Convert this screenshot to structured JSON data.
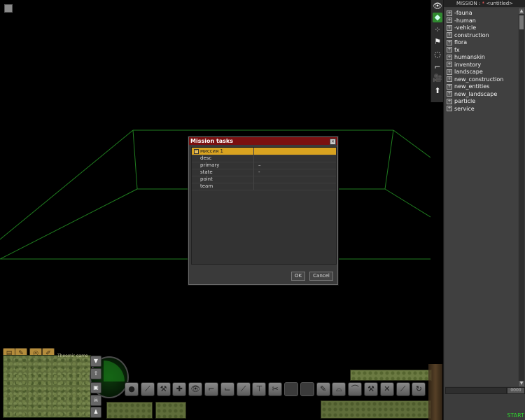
{
  "mission_header": {
    "label": "MISSION :",
    "modified_mark": "*",
    "name": "<untitled>"
  },
  "tool_strip": [
    {
      "name": "eye-icon",
      "glyph": "👁"
    },
    {
      "name": "entity-tool-icon",
      "glyph": "◆"
    },
    {
      "name": "grid-select-icon",
      "glyph": "⁘"
    },
    {
      "name": "flag-icon",
      "glyph": "⚑"
    },
    {
      "name": "circle-select-icon",
      "glyph": "◌"
    },
    {
      "name": "path-icon",
      "glyph": "⌐"
    },
    {
      "name": "camera-icon",
      "glyph": "🎥"
    },
    {
      "name": "arrow-up-icon",
      "glyph": "⬆"
    }
  ],
  "tree": {
    "items": [
      {
        "label": "-fauna"
      },
      {
        "label": "-human"
      },
      {
        "label": "-vehicle"
      },
      {
        "label": "construction"
      },
      {
        "label": "flora"
      },
      {
        "label": "fx"
      },
      {
        "label": "humanskin"
      },
      {
        "label": "inventory"
      },
      {
        "label": "landscape"
      },
      {
        "label": "new_construction"
      },
      {
        "label": "new_entities"
      },
      {
        "label": "new_landscape"
      },
      {
        "label": "particle"
      },
      {
        "label": "service"
      }
    ],
    "expand_glyph": "+",
    "scroll_up": "▲",
    "scroll_down": "▼"
  },
  "panel_field_value": "0000",
  "start_label": "START",
  "dialog": {
    "title": "Mission tasks",
    "close_glyph": "✕",
    "rows": [
      {
        "key": "миссия 1",
        "value": "",
        "selected": true
      },
      {
        "key": "desc",
        "value": ""
      },
      {
        "key": "primary",
        "value": "–"
      },
      {
        "key": "state",
        "value": "-"
      },
      {
        "key": "point",
        "value": ""
      },
      {
        "key": "team",
        "value": ""
      }
    ],
    "collapse_glyph": "−",
    "ok_label": "OK",
    "cancel_label": "Cancel"
  },
  "hud": {
    "top_buttons": [
      {
        "name": "map-icon",
        "glyph": "▤"
      },
      {
        "name": "pencil-icon",
        "glyph": "✎"
      },
      {
        "name": "compass-icon",
        "glyph": "◎"
      },
      {
        "name": "wrench-icon",
        "glyph": "✐"
      }
    ],
    "minimap_label": "Theomir game",
    "side_buttons": [
      {
        "name": "shield-icon",
        "glyph": "▼"
      },
      {
        "name": "unit-up-icon",
        "glyph": "⇧"
      },
      {
        "name": "crate-icon",
        "glyph": "▣"
      },
      {
        "name": "skull-icon",
        "glyph": "☠"
      },
      {
        "name": "team-icon",
        "glyph": "♟"
      }
    ]
  },
  "toolbar": [
    {
      "name": "grenade-icon",
      "glyph": "●"
    },
    {
      "name": "knife-icon",
      "glyph": "⟋"
    },
    {
      "name": "wrench-tool-icon",
      "glyph": "⚒"
    },
    {
      "name": "medkit-icon",
      "glyph": "✚"
    },
    {
      "name": "look-icon",
      "glyph": "👁"
    },
    {
      "name": "pistol-icon",
      "glyph": "⌐"
    },
    {
      "name": "gun-icon",
      "glyph": "⌙"
    },
    {
      "name": "rifle-icon",
      "glyph": "⟋"
    },
    {
      "name": "hammer-icon",
      "glyph": "⊤"
    },
    {
      "name": "scissors-icon",
      "glyph": "✂"
    },
    {
      "name": "empty-slot-icon",
      "glyph": "",
      "dark": true
    },
    {
      "name": "empty-slot-icon",
      "glyph": "",
      "dark": true
    },
    {
      "name": "pen-icon",
      "glyph": "✎"
    },
    {
      "name": "hat-icon",
      "glyph": "⌓"
    },
    {
      "name": "helmet-icon",
      "glyph": "⌒"
    },
    {
      "name": "tools-icon",
      "glyph": "⚒"
    },
    {
      "name": "cross-icon",
      "glyph": "✕"
    },
    {
      "name": "blade-icon",
      "glyph": "⟋"
    },
    {
      "name": "rotate-icon",
      "glyph": "↻"
    }
  ]
}
